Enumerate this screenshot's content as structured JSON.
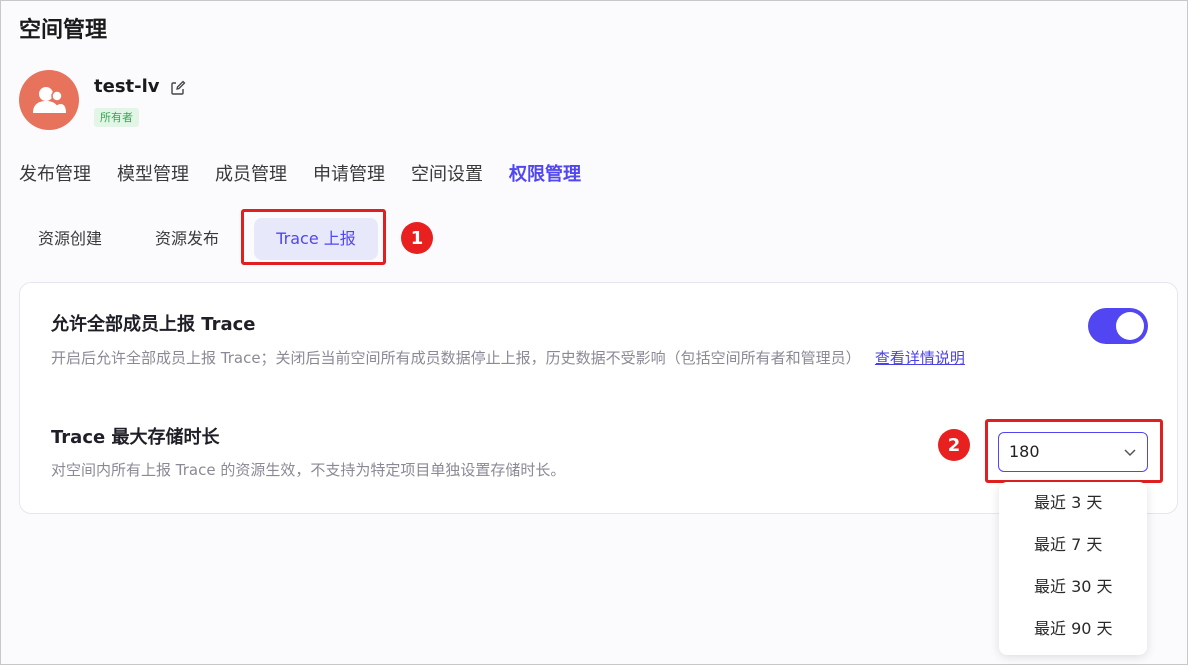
{
  "page": {
    "title": "空间管理"
  },
  "space": {
    "name": "test-lv",
    "role_badge": "所有者"
  },
  "main_tabs": [
    {
      "label": "发布管理"
    },
    {
      "label": "模型管理"
    },
    {
      "label": "成员管理"
    },
    {
      "label": "申请管理"
    },
    {
      "label": "空间设置"
    },
    {
      "label": "权限管理",
      "active": true
    }
  ],
  "sub_tabs": [
    {
      "label": "资源创建"
    },
    {
      "label": "资源发布"
    },
    {
      "label": "Trace 上报",
      "active": true
    }
  ],
  "annotations": {
    "step1": "1",
    "step2": "2"
  },
  "settings": {
    "trace_report": {
      "title": "允许全部成员上报 Trace",
      "description": "开启后允许全部成员上报 Trace；关闭后当前空间所有成员数据停止上报，历史数据不受影响（包括空间所有者和管理员）",
      "link_text": "查看详情说明",
      "enabled": true
    },
    "trace_retention": {
      "title": "Trace 最大存储时长",
      "description": "对空间内所有上报 Trace 的资源生效，不支持为特定项目单独设置存储时长。",
      "selected_value": "180",
      "options": [
        {
          "label": "最近 3 天"
        },
        {
          "label": "最近 7 天"
        },
        {
          "label": "最近 30 天"
        },
        {
          "label": "最近 90 天"
        }
      ]
    }
  },
  "colors": {
    "accent": "#5146f1",
    "highlight": "#e02020",
    "avatar": "#e8735c",
    "badge_green": "#36a852"
  }
}
